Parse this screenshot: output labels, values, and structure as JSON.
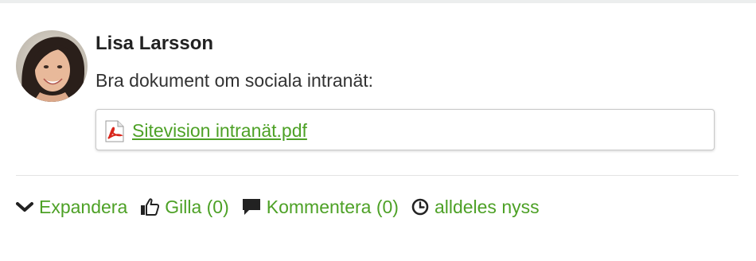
{
  "post": {
    "author": "Lisa Larsson",
    "text": "Bra dokument om sociala intranät:",
    "attachment": {
      "file_name": "Sitevision intranät.pdf",
      "icon": "pdf-file-icon"
    }
  },
  "actions": {
    "expand": {
      "label": "Expandera",
      "icon": "chevron-down-icon"
    },
    "like": {
      "label": "Gilla (0)",
      "icon": "thumbs-up-icon"
    },
    "comment": {
      "label": "Kommentera (0)",
      "icon": "comment-icon"
    },
    "time": {
      "label": "alldeles nyss",
      "icon": "clock-icon"
    }
  },
  "colors": {
    "link_green": "#4da126",
    "icon_dark": "#222222",
    "pdf_red": "#d9261c"
  }
}
